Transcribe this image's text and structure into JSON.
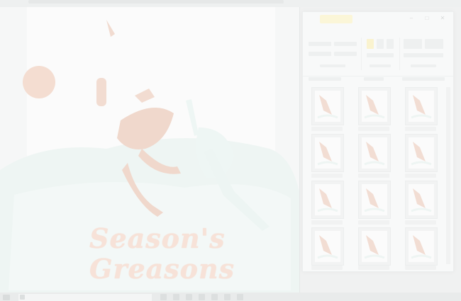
{
  "viewer": {
    "card_line1": "Season's",
    "card_line2": "Greasons",
    "colors": {
      "background": "#f6f7f7",
      "skin": "#f0d8cc",
      "snow": "#eaf3f1",
      "title": "#f7e2d8"
    }
  },
  "explorer": {
    "window_buttons": [
      "–",
      "□",
      "✕"
    ],
    "icons": [
      "folder-icon",
      "minimize-icon",
      "maximize-icon",
      "close-icon"
    ],
    "thumbnail_count": 12
  },
  "taskbar": {
    "icons": [
      "start-icon",
      "search-icon",
      "app-icon",
      "app-icon",
      "app-icon",
      "app-icon",
      "app-icon"
    ]
  }
}
